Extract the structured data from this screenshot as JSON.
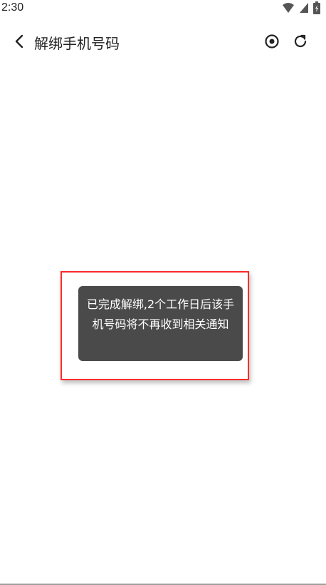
{
  "status_bar": {
    "time": "2:30",
    "icons": [
      "wifi-icon",
      "signal-icon",
      "battery-icon"
    ]
  },
  "app_bar": {
    "title": "解绑手机号码",
    "icons": [
      "back-icon",
      "target-icon",
      "refresh-icon"
    ]
  },
  "toast": {
    "message": "已完成解绑,2个工作日后该手机号码将不再收到相关通知"
  },
  "colors": {
    "toast_background": "#4a4a4a",
    "highlight_border": "#ff2b2b"
  }
}
